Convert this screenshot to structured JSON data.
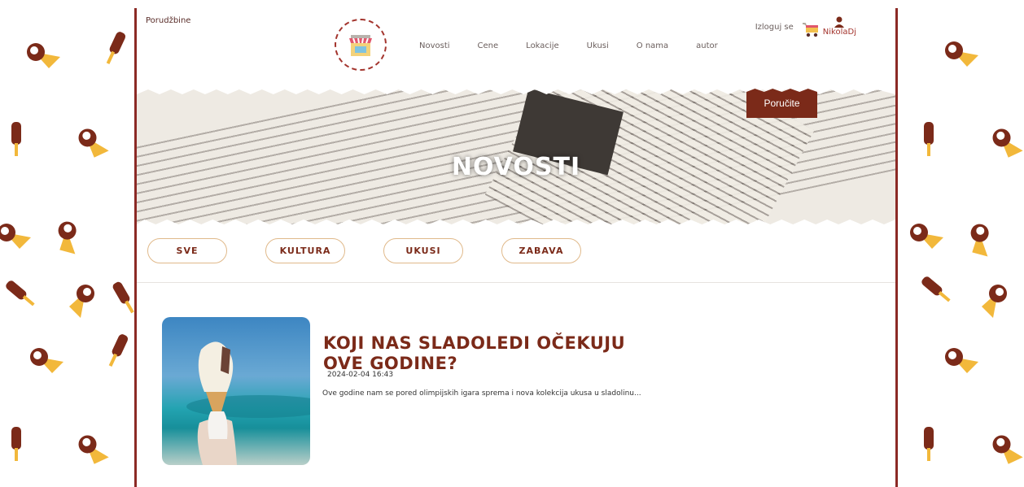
{
  "header": {
    "orders_link": "Porudžbine",
    "nav": [
      "Novosti",
      "Cene",
      "Lokacije",
      "Ukusi",
      "O nama",
      "autor"
    ],
    "logout": "Izloguj se",
    "username": "NikolaDj"
  },
  "hero": {
    "title": "NOVOSTI",
    "order_button": "Poručite"
  },
  "filters": [
    "SVE",
    "KULTURA",
    "UKUSI",
    "ZABAVA"
  ],
  "article": {
    "title": "KOJI NAS SLADOLEDI OČEKUJU OVE GODINE?",
    "date": "2024-02-04 16:43",
    "excerpt": "Ove godine nam se pored olimpijskih igara sprema i nova kolekcija ukusa u sladolinu..."
  },
  "colors": {
    "brand": "#7b2a19",
    "border": "#8b2a25",
    "pill_border": "#e0b98a"
  },
  "icons": [
    "store-logo-icon",
    "cart-icon",
    "user-icon",
    "ice-cream-cone-icon",
    "ice-cream-bar-icon"
  ]
}
